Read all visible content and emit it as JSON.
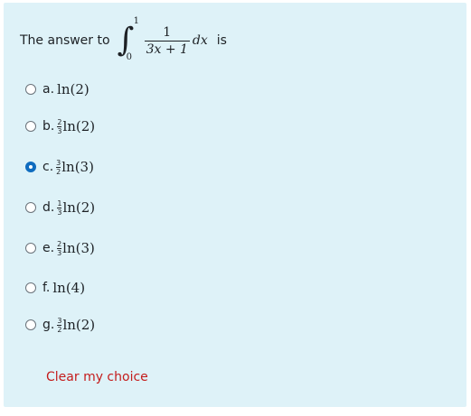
{
  "question": {
    "prefix": "The answer to",
    "integral_upper": "1",
    "integral_lower": "0",
    "integrand_numerator": "1",
    "integrand_denominator": "3x + 1",
    "differential": "dx",
    "suffix": "is"
  },
  "options": [
    {
      "letter": "a.",
      "coef_num": "",
      "coef_den": "",
      "expr": "ln(2)",
      "selected": false
    },
    {
      "letter": "b.",
      "coef_num": "2",
      "coef_den": "3",
      "expr": "ln(2)",
      "selected": false
    },
    {
      "letter": "c.",
      "coef_num": "3",
      "coef_den": "2",
      "expr": "ln(3)",
      "selected": true
    },
    {
      "letter": "d.",
      "coef_num": "1",
      "coef_den": "3",
      "expr": "ln(2)",
      "selected": false
    },
    {
      "letter": "e.",
      "coef_num": "2",
      "coef_den": "3",
      "expr": "ln(3)",
      "selected": false
    },
    {
      "letter": "f.",
      "coef_num": "",
      "coef_den": "",
      "expr": "ln(4)",
      "selected": false
    },
    {
      "letter": "g.",
      "coef_num": "3",
      "coef_den": "2",
      "expr": "ln(2)",
      "selected": false
    }
  ],
  "clear_label": "Clear my choice",
  "colors": {
    "panel_bg": "#def2f8",
    "radio_selected": "#0f6cbf",
    "link": "#c41c1c"
  }
}
